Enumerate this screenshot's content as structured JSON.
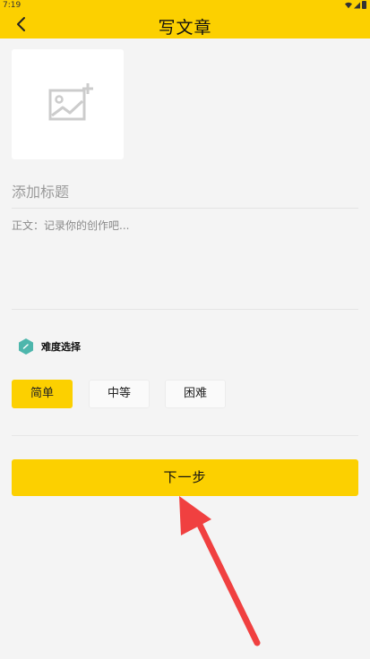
{
  "status_bar": {
    "time": "7:19"
  },
  "header": {
    "title": "写文章",
    "back_icon": "chevron-left-icon"
  },
  "cover": {
    "icon": "add-image-icon"
  },
  "form": {
    "title_placeholder": "添加标题",
    "body_placeholder": "正文：记录你的创作吧..."
  },
  "difficulty": {
    "label": "难度选择",
    "options": [
      {
        "label": "简单",
        "selected": true
      },
      {
        "label": "中等",
        "selected": false
      },
      {
        "label": "困难",
        "selected": false
      }
    ]
  },
  "actions": {
    "next_label": "下一步"
  },
  "colors": {
    "accent": "#fcd000",
    "background": "#f4f4f4",
    "difficulty_icon": "#4db6ac",
    "annotation_arrow": "#f04040"
  }
}
